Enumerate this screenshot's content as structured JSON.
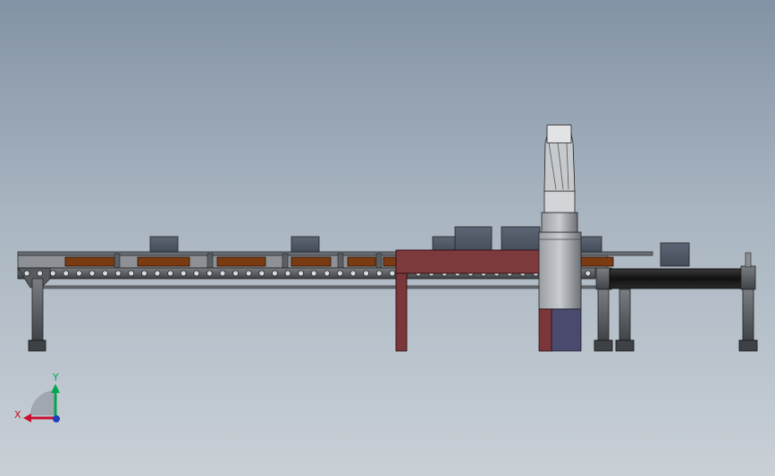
{
  "triad": {
    "x_label": "X",
    "y_label": "Y",
    "x_color": "#c8102e",
    "y_color": "#00a651",
    "z_color": "#1f3fbf"
  },
  "colors": {
    "background_top": "#8393a5",
    "background_bottom": "#c9d0d6",
    "frame_metal": "#5b5e62",
    "wood_board": "#7a3a12",
    "red_table": "#7d3a3c",
    "box_gray": "#4e5866",
    "motor_blue": "#4a4a6e",
    "belt_black": "#1c1c1c"
  }
}
